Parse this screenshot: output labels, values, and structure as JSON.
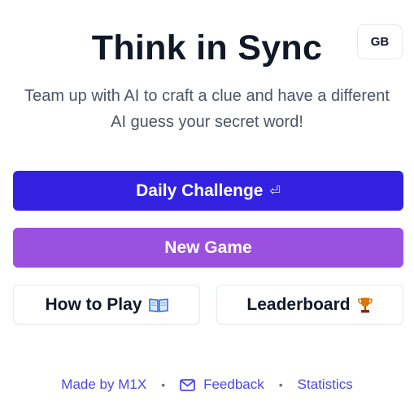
{
  "header": {
    "title": "Think in Sync",
    "language_label": "GB"
  },
  "intro": {
    "subtitle": "Team up with AI to craft a clue and have a different AI guess your secret word!"
  },
  "actions": {
    "daily_challenge_label": "Daily Challenge",
    "daily_challenge_icon": "return-arrow-icon",
    "new_game_label": "New Game",
    "how_to_play_label": "How to Play",
    "how_to_play_icon": "book-icon",
    "leaderboard_label": "Leaderboard",
    "leaderboard_icon": "trophy-icon"
  },
  "footer": {
    "made_by": "Made by M1X",
    "feedback": "Feedback",
    "statistics": "Statistics",
    "separator": "•"
  },
  "colors": {
    "primary": "#3222e0",
    "secondary": "#9b51e0",
    "link": "#4f46e5",
    "text": "#111827",
    "muted": "#4b5563"
  }
}
